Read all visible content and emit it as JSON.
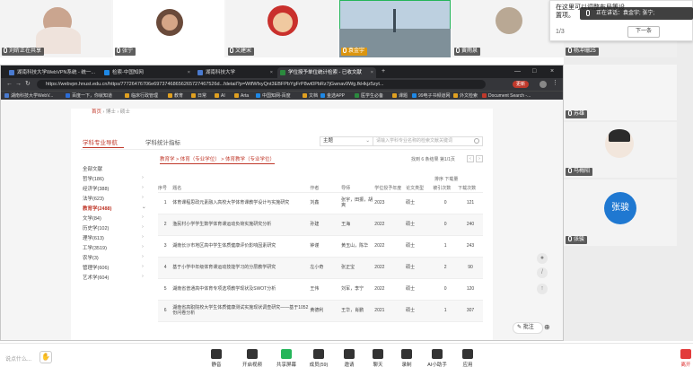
{
  "video_tiles": [
    {
      "name": "刘昕正在共享"
    },
    {
      "name": "张宁"
    },
    {
      "name": "文建宋"
    },
    {
      "name": "袁金宇"
    },
    {
      "name": "黄雨泉"
    },
    {
      "name": "杨冲珊25"
    }
  ],
  "right_tiles": [
    {
      "name": "苏雄"
    },
    {
      "name": "马梅阳"
    },
    {
      "name": "张骏",
      "avatar_text": "张骏"
    }
  ],
  "popup": {
    "question": "在这里可以调整布局等设置项。",
    "page": "1/3",
    "next": "下一条",
    "speaking": "正在讲话：袁金宇; 张宁;"
  },
  "browser": {
    "tabs": [
      {
        "label": "湖南科技大学WebVPN系统 - 统一..."
      },
      {
        "label": "检索-中国知网"
      },
      {
        "label": "湖南科技大学"
      },
      {
        "label": "学位授予单位统计检索 - 已收文献"
      }
    ],
    "url": "https://webvpn.hnust.edu.cn/https/77726476706e69737468656265727467526d...fdetail?p=WtfWfxyQnt3EBFPbYgFrP8wt0PbRz7jGwnav9Wg.fkHkjz5zyt...",
    "profile": "更新",
    "bookmarks": [
      "湖南科技大学WebV...",
      "百度一下，你就知道",
      "临床行政管理",
      "教育",
      "日常",
      "AI",
      "Arta",
      "中国知网-百度",
      "文档",
      "金选APP",
      "医学生必备",
      "课题",
      "99电子书频道网",
      "外文检索",
      "Document Search -..."
    ]
  },
  "page": {
    "breadcrumb": {
      "home": "首页",
      "mid": "博士",
      "leaf": "硕士"
    },
    "subtabs": [
      "学科专业导航",
      "学科授予单位",
      "学科统计指标"
    ],
    "select_value": "主题",
    "search_placeholder": "请输入学科专业名称的检索文献关键词",
    "filter_tag": "教育学 > 体育（专业学位） > 体育教学（专业学位）",
    "count": "找到 6 条结果",
    "page_indicator": "第1/1页",
    "sort_label": "排序 下载量",
    "left_filters": [
      "全部文献",
      "哲学(186)",
      "经济学(388)",
      "法学(623)",
      "教育学(2488)",
      "文学(84)",
      "历史学(102)",
      "理学(613)",
      "工学(3519)",
      "农学(3)",
      "管理学(606)",
      "艺术学(604)"
    ],
    "table_headers": [
      "序号",
      "题名",
      "作者",
      "导师",
      "学位授予年度",
      "论文类型",
      "被引次数",
      "下载次数"
    ],
    "rows": [
      {
        "no": "1",
        "title": "体育课程思政元素融入高校大学体育课教学设计与实施研究",
        "author": "刘鑫",
        "advisor": "张宇，田振，胡爽",
        "year": "2023",
        "type": "硕士",
        "cited": "0",
        "downloads": "121"
      },
      {
        "no": "2",
        "title": "渔民村小学学生数学体育课运动负荷实施研究分析",
        "author": "孙建",
        "advisor": "王海",
        "year": "2022",
        "type": "硕士",
        "cited": "0",
        "downloads": "240"
      },
      {
        "no": "3",
        "title": "湖南长沙市地区高中学生体质健康评价影响因素研究",
        "author": "钟谨",
        "advisor": "黄玉山，陈华",
        "year": "2022",
        "type": "硕士",
        "cited": "1",
        "downloads": "243"
      },
      {
        "no": "4",
        "title": "基于小学中年级体育课运动技能学习的分层教学研究",
        "author": "左小奇",
        "advisor": "张正宝",
        "year": "2022",
        "type": "硕士",
        "cited": "2",
        "downloads": "90"
      },
      {
        "no": "5",
        "title": "湖南省普通高中体育专项选项教学现状及SWOT分析",
        "author": "王伟",
        "advisor": "刘军，李宁",
        "year": "2022",
        "type": "硕士",
        "cited": "0",
        "downloads": "120"
      },
      {
        "no": "6",
        "title": "湖南省高职院校大学生体质健康测试实施现状调查研究——基于1052份问卷分析",
        "author": "黄德利",
        "advisor": "王华，肖鹏",
        "year": "2021",
        "type": "硕士",
        "cited": "1",
        "downloads": "307"
      }
    ],
    "annotate": "批注"
  },
  "toolbar": {
    "chat_placeholder": "说点什么...",
    "items": [
      "静音",
      "开启视频",
      "共享屏幕",
      "成员(59)",
      "邀请",
      "聊天",
      "录制",
      "AI小助手",
      "应用"
    ],
    "end": "离开"
  }
}
